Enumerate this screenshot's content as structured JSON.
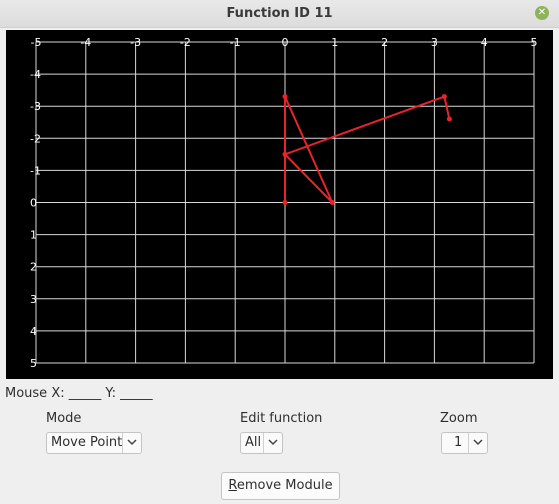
{
  "window": {
    "title": "Function ID 11"
  },
  "plot": {
    "x_ticks": [
      "-5",
      "-4",
      "-3",
      "-2",
      "-1",
      "0",
      "1",
      "2",
      "3",
      "4",
      "5"
    ],
    "y_ticks": [
      "-4",
      "-3",
      "-2",
      "-1",
      "0",
      "1",
      "2",
      "3",
      "4",
      "5"
    ],
    "xlim": [
      -5,
      5
    ],
    "ylim": [
      -5,
      5
    ],
    "grid": true,
    "line_color": "#e8232b",
    "points": [
      {
        "x": 0,
        "y": 0
      },
      {
        "x": 0,
        "y": -3.3
      },
      {
        "x": 0.95,
        "y": 0
      },
      {
        "x": 0,
        "y": -1.5
      },
      {
        "x": 3.2,
        "y": -3.3
      },
      {
        "x": 3.3,
        "y": -2.6
      }
    ]
  },
  "mouse": {
    "label_x": "Mouse X:",
    "value_x": "_____",
    "label_y": "Y:",
    "value_y": "_____"
  },
  "mode": {
    "label": "Mode",
    "value": "Move Point"
  },
  "edit_function": {
    "label": "Edit function",
    "value": "All"
  },
  "zoom": {
    "label": "Zoom",
    "value": "1"
  },
  "remove_button": {
    "mnemonic": "R",
    "rest": "emove Module"
  },
  "close_icon": "close-icon"
}
